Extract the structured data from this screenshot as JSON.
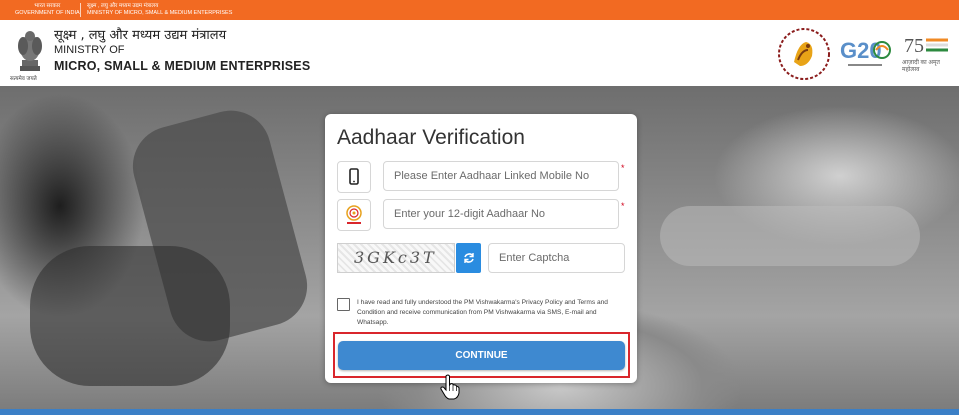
{
  "gov_bar": {
    "left_hindi": "भारत सरकार",
    "left_english": "GOVERNMENT OF INDIA",
    "right_hindi": "सूक्ष्म , लघु और मध्यम उद्यम मंत्रालय",
    "right_english": "MINISTRY OF MICRO, SMALL & MEDIUM ENTERPRISES",
    "bar_color": "#f26a22"
  },
  "header": {
    "ministry_hindi": "सूक्ष्म , लघु और मध्यम उद्यम मंत्रालय",
    "ministry_of": "MINISTRY OF",
    "ministry_name": "MICRO, SMALL & MEDIUM ENTERPRISES",
    "emblem_caption": "सत्यमेव जयते",
    "logos": [
      "pm-vishwakarma-logo",
      "g20-logo",
      "azadi-ka-amrit-mahotsav-logo"
    ],
    "g20_text": "G20",
    "azadi_text": "आज़ादी का अमृत महोत्सव"
  },
  "form": {
    "title": "Aadhaar Verification",
    "mobile_placeholder": "Please Enter Aadhaar Linked Mobile No",
    "aadhaar_placeholder": "Enter your 12-digit Aadhaar No",
    "captcha_text": "3GKc3T",
    "captcha_placeholder": "Enter Captcha",
    "required_mark": "*",
    "consent_text": "I have read and fully understood the PM Vishwakarma's Privacy Policy and Terms and Condition and receive communication from PM Vishwakarma via SMS, E-mail and Whatsapp.",
    "continue_label": "CONTINUE",
    "accent_color": "#3e89d0",
    "highlight_color": "#d9262c"
  }
}
